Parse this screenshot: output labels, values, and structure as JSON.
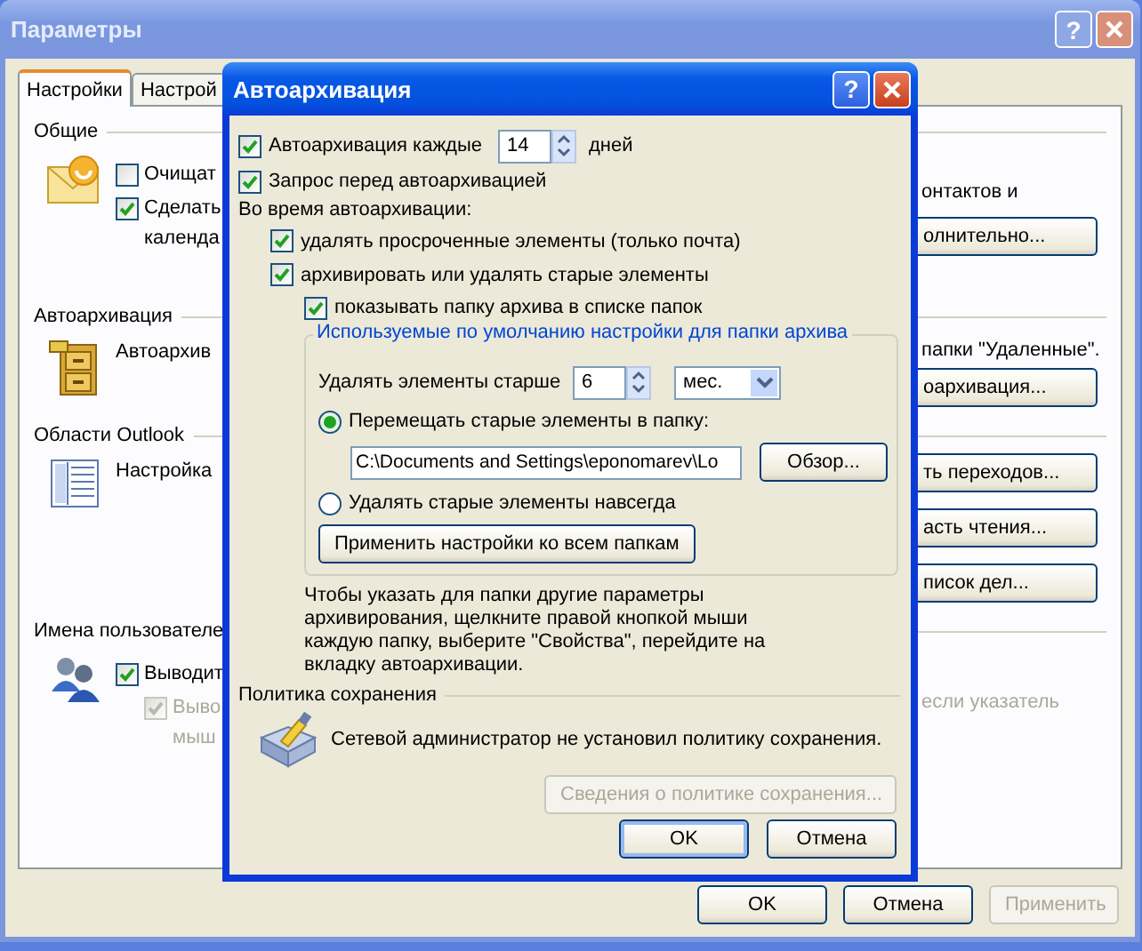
{
  "main_window": {
    "title": "Параметры",
    "help": "?",
    "tabs": [
      {
        "label": "Настройки",
        "selected": true
      },
      {
        "label": "Настрой",
        "selected": false
      }
    ],
    "sections": [
      {
        "label": "Общие",
        "items": [
          {
            "kind": "checkbox",
            "label": "Очищат",
            "checked": false,
            "disabled": false
          },
          {
            "kind": "checkbox",
            "label": "Сделать",
            "checked": true,
            "disabled": false
          },
          {
            "kind": "text",
            "label": "календа",
            "disabled": false
          }
        ],
        "right": [
          {
            "kind": "text",
            "label": "онтактов и",
            "disabled": false
          },
          {
            "kind": "button",
            "label": "олнительно...",
            "disabled": false
          }
        ]
      },
      {
        "label": "Автоархивация",
        "items": [
          {
            "kind": "text",
            "label": "Автоархив",
            "disabled": false
          }
        ],
        "right": [
          {
            "kind": "text",
            "label": "папки \"Удаленные\".",
            "disabled": false
          },
          {
            "kind": "button",
            "label": "оархивация...",
            "disabled": false
          }
        ]
      },
      {
        "label": "Области Outlook",
        "items": [
          {
            "kind": "text",
            "label": "Настройка",
            "disabled": false
          }
        ],
        "right": [
          {
            "kind": "button",
            "label": "ть переходов...",
            "disabled": false
          },
          {
            "kind": "button",
            "label": "асть чтения...",
            "disabled": false
          },
          {
            "kind": "button",
            "label": "писок дел...",
            "disabled": false
          }
        ]
      },
      {
        "label": "Имена пользователе",
        "items": [
          {
            "kind": "checkbox",
            "label": "Выводит",
            "checked": true,
            "disabled": false
          },
          {
            "kind": "checkbox",
            "label": "Выво",
            "checked": true,
            "disabled": true
          },
          {
            "kind": "text",
            "label": "мыш",
            "disabled": true
          }
        ],
        "right": [
          {
            "kind": "text",
            "label": "если указатель",
            "disabled": true
          }
        ]
      }
    ],
    "buttons": [
      {
        "label": "OK",
        "disabled": false
      },
      {
        "label": "Отмена",
        "disabled": false
      },
      {
        "label": "Применить",
        "disabled": true
      }
    ]
  },
  "autoarchive_dialog": {
    "title": "Автоархивация",
    "help": "?",
    "every": {
      "label": "Автоархивация каждые",
      "checked": true,
      "value": "14",
      "unit": "дней"
    },
    "prompt": {
      "label": "Запрос перед автоархивацией",
      "checked": true
    },
    "during_label": "Во время автоархивации:",
    "options": [
      {
        "label": "удалять просроченные элементы (только почта)",
        "checked": true
      },
      {
        "label": "архивировать или удалять старые элементы",
        "checked": true,
        "children": [
          {
            "label": "показывать папку архива в списке папок",
            "checked": true
          }
        ]
      }
    ],
    "defaults_group": {
      "legend": "Используемые по умолчанию настройки для папки архива",
      "age_label": "Удалять элементы старше",
      "age_value": "6",
      "age_unit": "мес.",
      "choices": [
        {
          "label": "Перемещать старые элементы в папку:",
          "selected": true
        },
        {
          "label": "Удалять старые элементы навсегда",
          "selected": false
        }
      ],
      "folder_path": "C:\\Documents and Settings\\eponomarev\\Lo",
      "browse_button": "Обзор...",
      "apply_all_button": "Применить настройки ко всем папкам"
    },
    "hint": "Чтобы указать для папки другие параметры архивирования, щелкните правой кнопкой мыши каждую папку, выберите \"Свойства\", перейдите на вкладку автоархивации.",
    "policy": {
      "label": "Политика сохранения",
      "text": "Сетевой администратор не установил политику сохранения.",
      "details_button": {
        "label": "Сведения о политике сохранения...",
        "disabled": true
      }
    },
    "buttons": [
      {
        "label": "OK",
        "default": true
      },
      {
        "label": "Отмена",
        "default": false
      }
    ]
  }
}
